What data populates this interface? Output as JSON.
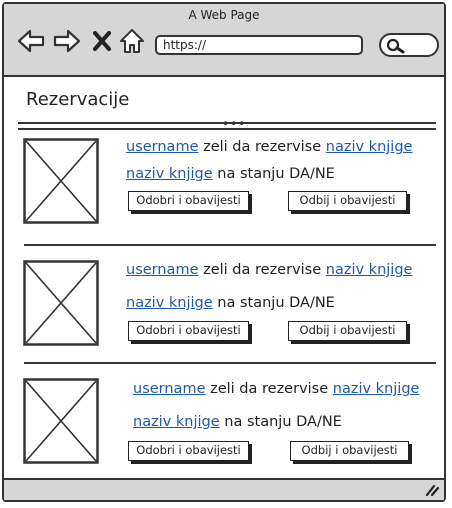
{
  "browser": {
    "window_title": "A Web Page",
    "url": "https://",
    "icons": [
      "back-arrow-icon",
      "forward-arrow-icon",
      "close-x-icon",
      "home-icon",
      "search-icon",
      "resize-grip-icon"
    ]
  },
  "page": {
    "title": "Rezervacije",
    "scroll_indicator": "•••"
  },
  "reservations": [
    {
      "username": "username",
      "verb": "zeli da rezervise",
      "book1": "naziv knjige",
      "book2": "naziv knjige",
      "status": "na stanju DA/NE",
      "approve_label": "Odobri i obavijesti",
      "reject_label": "Odbij i obavijesti"
    },
    {
      "username": "username",
      "verb": "zeli da rezervise",
      "book1": "naziv knjige",
      "book2": "naziv knjige",
      "status": "na stanju DA/NE",
      "approve_label": "Odobri i obavijesti",
      "reject_label": "Odbij i obavijesti"
    },
    {
      "username": "username",
      "verb": "zeli da rezervise",
      "book1": "naziv knjige",
      "book2": "naziv knjige",
      "status": "na stanju DA/NE",
      "approve_label": "Odobri i obavijesti",
      "reject_label": "Odbij i obavijesti"
    }
  ],
  "colors": {
    "link": "#1f5aa8",
    "chrome": "#d6d6d6",
    "stroke": "#333333"
  }
}
